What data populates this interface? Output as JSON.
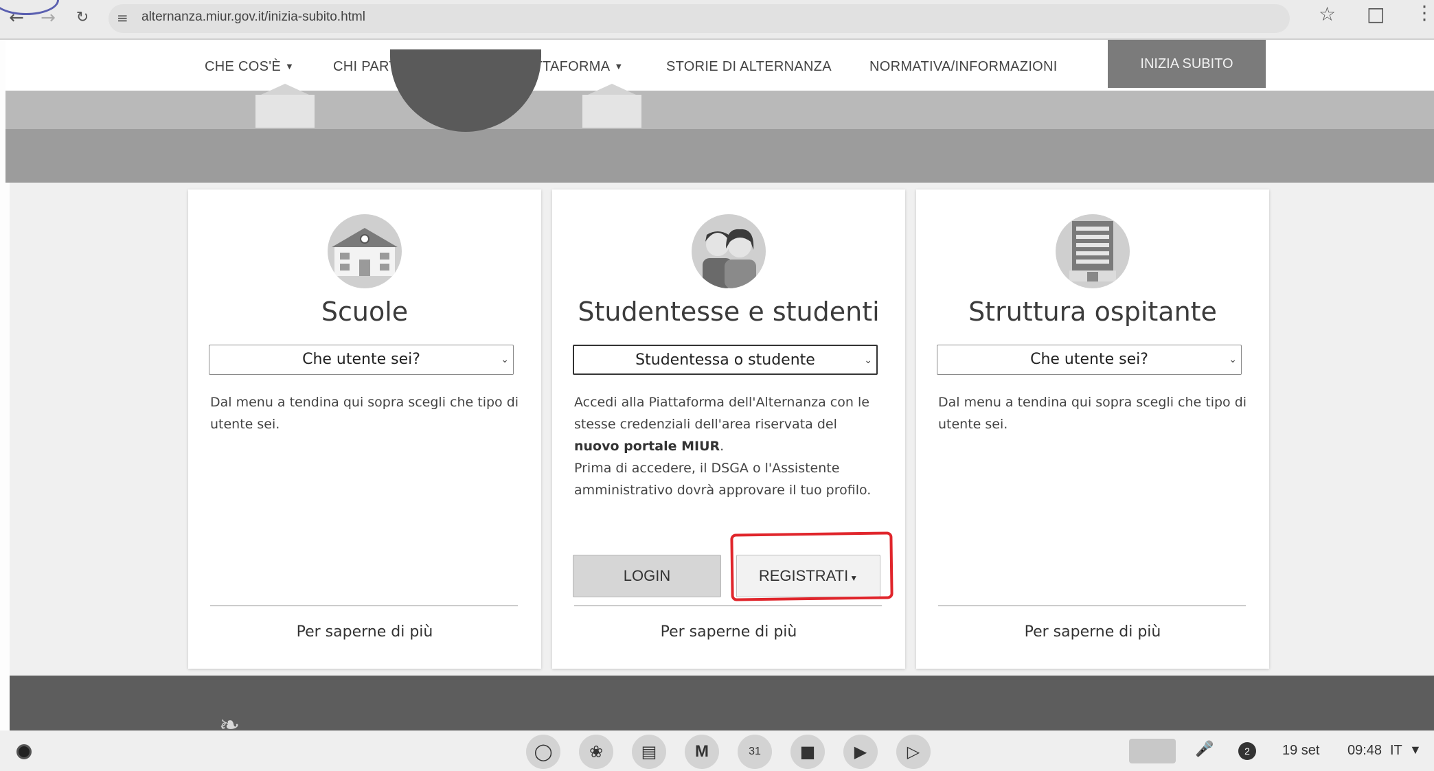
{
  "browser": {
    "url": "alternanza.miur.gov.it/inizia-subito.html",
    "back_icon": "arrow-left-icon",
    "forward_icon": "arrow-right-icon",
    "reload_icon": "reload-icon"
  },
  "nav": {
    "items": [
      {
        "label": "CHE COS'È",
        "has_dropdown": true
      },
      {
        "label": "CHI PARTECIPA",
        "has_dropdown": true
      },
      {
        "label": "LA PIATTAFORMA",
        "has_dropdown": true
      },
      {
        "label": "STORIE DI ALTERNANZA",
        "has_dropdown": false
      },
      {
        "label": "NORMATIVA/INFORMAZIONI",
        "has_dropdown": false
      }
    ],
    "cta_label": "INIZIA SUBITO"
  },
  "cards": [
    {
      "title": "Scuole",
      "icon": "school-icon",
      "select_value": "Che utente sei?",
      "text": "Dal menu a tendina qui sopra scegli che tipo di utente sei.",
      "more_label": "Per saperne di più"
    },
    {
      "title": "Studentesse e studenti",
      "icon": "students-icon",
      "select_value": "Studentessa o studente",
      "text_part1": "Accedi alla Piattaforma dell'Alternanza con le stesse credenziali dell'area riservata del ",
      "text_bold": "nuovo portale MIUR",
      "text_part2": ".",
      "text_line2": "Prima di accedere, il DSGA o l'Assistente amministrativo dovrà approvare il tuo profilo.",
      "login_label": "LOGIN",
      "register_label": "REGISTRATI",
      "more_label": "Per saperne di più"
    },
    {
      "title": "Struttura ospitante",
      "icon": "building-icon",
      "select_value": "Che utente sei?",
      "text": "Dal menu a tendina qui sopra scegli che tipo di utente sei.",
      "more_label": "Per saperne di più"
    }
  ],
  "annotation": {
    "color": "#e0252b",
    "target": "register-button"
  },
  "taskbar": {
    "apps": [
      "chrome-icon",
      "palette-icon",
      "slides-icon",
      "gmail-icon",
      "calendar-icon",
      "files-icon",
      "play-store-icon",
      "youtube-icon"
    ],
    "calendar_day": "31",
    "notification_count": "2",
    "date": "19 set",
    "time": "09:48",
    "lang": "IT"
  }
}
